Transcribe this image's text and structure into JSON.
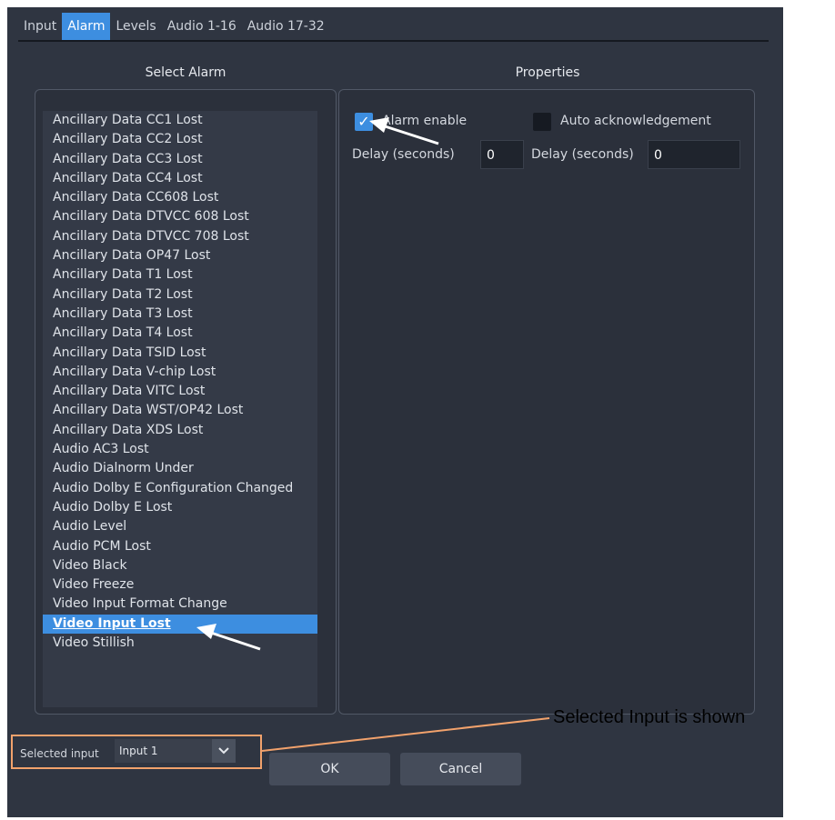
{
  "tabs": [
    {
      "label": "Input",
      "active": false
    },
    {
      "label": "Alarm",
      "active": true
    },
    {
      "label": "Levels",
      "active": false
    },
    {
      "label": "Audio 1-16",
      "active": false
    },
    {
      "label": "Audio 17-32",
      "active": false
    }
  ],
  "select_alarm": {
    "title": "Select Alarm",
    "items": [
      "Ancillary Data CC1 Lost",
      "Ancillary Data CC2 Lost",
      "Ancillary Data CC3 Lost",
      "Ancillary Data CC4 Lost",
      "Ancillary Data CC608 Lost",
      "Ancillary Data DTVCC 608 Lost",
      "Ancillary Data DTVCC 708 Lost",
      "Ancillary Data OP47 Lost",
      "Ancillary Data T1 Lost",
      "Ancillary Data T2 Lost",
      "Ancillary Data T3 Lost",
      "Ancillary Data T4 Lost",
      "Ancillary Data TSID Lost",
      "Ancillary Data V-chip Lost",
      "Ancillary Data VITC Lost",
      "Ancillary Data WST/OP42 Lost",
      "Ancillary Data XDS Lost",
      "Audio AC3 Lost",
      "Audio Dialnorm Under",
      "Audio Dolby E Configuration Changed",
      "Audio Dolby E Lost",
      "Audio Level",
      "Audio PCM Lost",
      "Video Black",
      "Video Freeze",
      "Video Input Format Change",
      "Video Input Lost",
      "Video Stillish"
    ],
    "selected": "Video Input Lost"
  },
  "properties": {
    "title": "Properties",
    "alarm_enable": {
      "label": "Alarm enable",
      "checked": true
    },
    "auto_ack": {
      "label": "Auto acknowledgement",
      "checked": false
    },
    "delay1": {
      "label": "Delay (seconds)",
      "value": "0"
    },
    "delay2": {
      "label": "Delay (seconds)",
      "value": "0"
    }
  },
  "selected_input": {
    "label": "Selected input",
    "value": "Input 1"
  },
  "buttons": {
    "ok": "OK",
    "cancel": "Cancel"
  },
  "annotation": {
    "callout": "Selected Input is shown"
  },
  "colors": {
    "accent": "#3d8ee0",
    "dialog_bg": "#2f3541",
    "annotation": "#f2a26c"
  }
}
